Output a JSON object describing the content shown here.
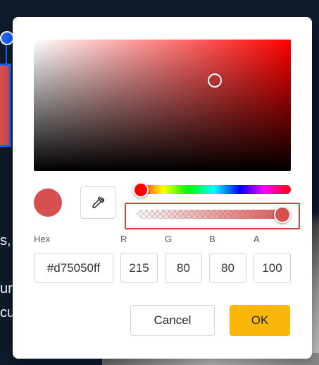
{
  "background": {
    "left_text_lines": [
      "s,",
      "ur",
      "cu"
    ]
  },
  "picker": {
    "color_hex_display": "#d75050",
    "hue_color": "#ff0000",
    "hue_level": 0.0,
    "alpha_level": 1.0,
    "labels": {
      "hex": "Hex",
      "r": "R",
      "g": "G",
      "b": "B",
      "a": "A"
    },
    "values": {
      "hex": "#d75050ff",
      "r": "215",
      "g": "80",
      "b": "80",
      "a": "100"
    },
    "icons": {
      "eyedropper": "eyedropper-icon"
    }
  },
  "buttons": {
    "cancel": "Cancel",
    "ok": "OK"
  },
  "colors": {
    "accent_ok": "#fbb60a",
    "highlight_border": "#d9423f",
    "selection_blue": "#1e64ff"
  }
}
